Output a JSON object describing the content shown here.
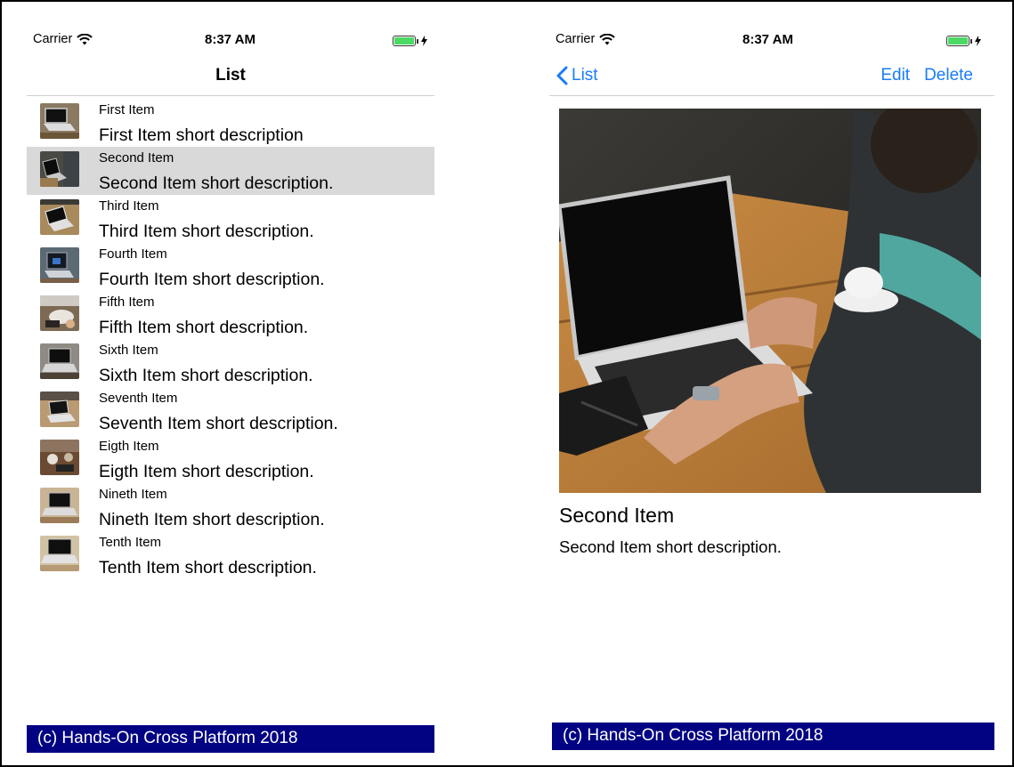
{
  "left_screen": {
    "status": {
      "carrier": "Carrier",
      "time": "8:37 AM"
    },
    "nav": {
      "title": "List"
    },
    "items": [
      {
        "name": "First Item",
        "description": "First Item short description"
      },
      {
        "name": "Second Item",
        "description": "Second Item short description."
      },
      {
        "name": "Third Item",
        "description": "Third Item short description."
      },
      {
        "name": "Fourth Item",
        "description": "Fourth Item short description."
      },
      {
        "name": "Fifth Item",
        "description": "Fifth Item short description."
      },
      {
        "name": "Sixth Item",
        "description": "Sixth Item short description."
      },
      {
        "name": "Seventh Item",
        "description": "Seventh Item short description."
      },
      {
        "name": "Eigth Item",
        "description": "Eigth Item short description."
      },
      {
        "name": "Nineth Item",
        "description": "Nineth Item short description."
      },
      {
        "name": "Tenth Item",
        "description": "Tenth Item short description."
      }
    ],
    "selected_index": 1,
    "footer": "(c) Hands-On Cross Platform 2018"
  },
  "right_screen": {
    "status": {
      "carrier": "Carrier",
      "time": "8:37 AM"
    },
    "nav": {
      "back_label": "List",
      "edit_label": "Edit",
      "delete_label": "Delete"
    },
    "detail": {
      "title": "Second Item",
      "description": "Second Item short description."
    },
    "footer": "(c) Hands-On Cross Platform 2018"
  },
  "icons": [
    "wifi-icon",
    "battery-icon",
    "charging-bolt-icon",
    "chevron-left-icon"
  ],
  "colors": {
    "accent": "#1a7cf8",
    "footer_bg": "#020382",
    "selected_row": "#d9d9d9",
    "battery": "#4cd964"
  }
}
